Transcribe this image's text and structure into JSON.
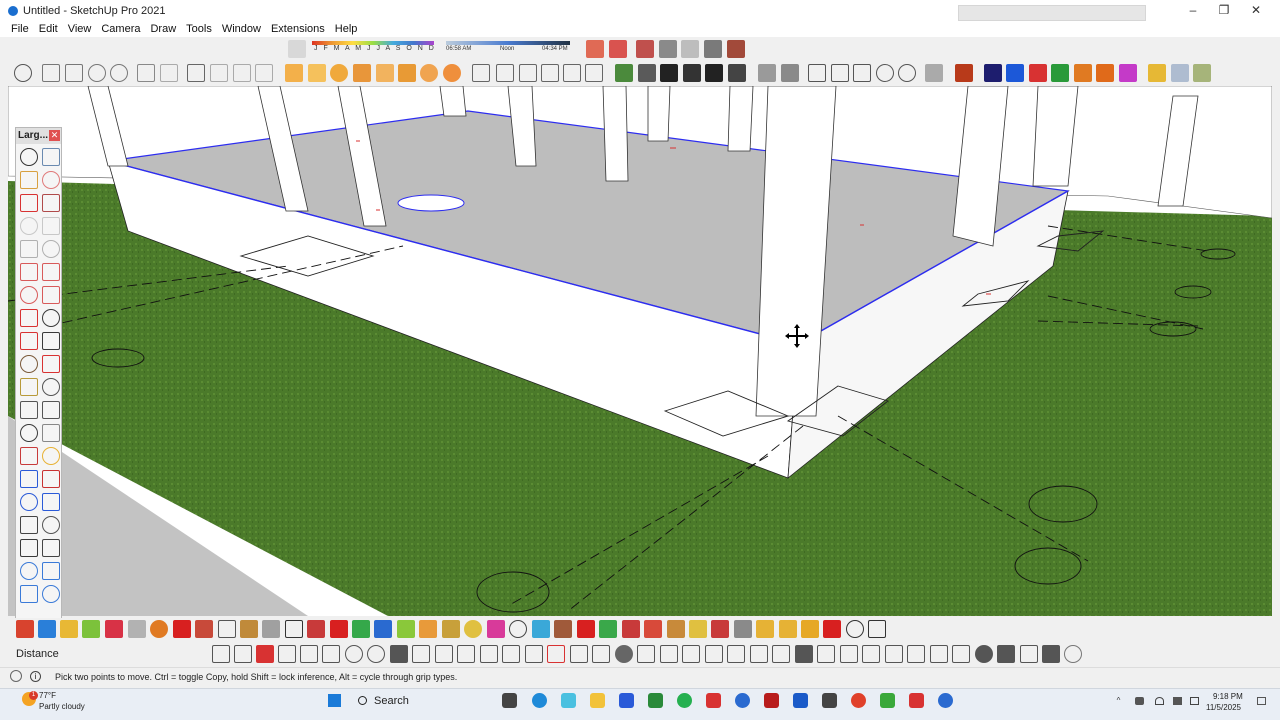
{
  "window": {
    "title": "Untitled - SketchUp Pro 2021",
    "controls": [
      "–",
      "❐",
      "✕"
    ]
  },
  "menu": [
    "File",
    "Edit",
    "View",
    "Camera",
    "Draw",
    "Tools",
    "Window",
    "Extensions",
    "Help"
  ],
  "shadow_settings": {
    "months": "J F M A M J J A S O N D",
    "time_start": "06:58 AM",
    "time_noon": "Noon",
    "time_end": "04:34 PM"
  },
  "palette": {
    "title": "Larg...",
    "close": "✕",
    "tools": [
      "select-icon",
      "component-icon",
      "paint-bucket-icon",
      "eraser-icon",
      "pencil-icon",
      "freehand-icon",
      "rectangle-icon",
      "rotated-rectangle-icon",
      "circle-icon",
      "polygon-icon",
      "arc-icon",
      "two-point-arc-icon",
      "three-point-arc-icon",
      "pie-icon",
      "move-icon",
      "push-pull-icon",
      "rotate-icon",
      "follow-me-icon",
      "scale-icon",
      "offset-icon",
      "tape-measure-icon",
      "dimension-icon",
      "protractor-icon",
      "text-icon",
      "axes-icon",
      "3d-text-icon",
      "orbit-icon",
      "pan-icon",
      "zoom-icon",
      "zoom-window-icon",
      "zoom-extents-icon",
      "previous-view-icon",
      "position-camera-icon",
      "look-around-icon",
      "walk-icon",
      "section-plane-icon",
      "display-section-icon",
      "section-cuts-icon",
      "sandbox-icon",
      "sandbox-smoove-icon"
    ]
  },
  "vcb": {
    "label": "Distance",
    "value": ""
  },
  "status": {
    "hint": "Pick two points to move.  Ctrl = toggle Copy, hold Shift = lock inference, Alt = cycle through grip types."
  },
  "taskbar": {
    "weather_temp": "77°F",
    "weather_desc": "Partly cloudy",
    "weather_badge": "1",
    "search": "Search",
    "time": "9:18 PM",
    "date": "11/5/2025"
  },
  "colors": {
    "ground": "#4b7a2a",
    "slab": "#bfbfbf",
    "selection": "#2d2df0",
    "sky": "#ffffff"
  }
}
